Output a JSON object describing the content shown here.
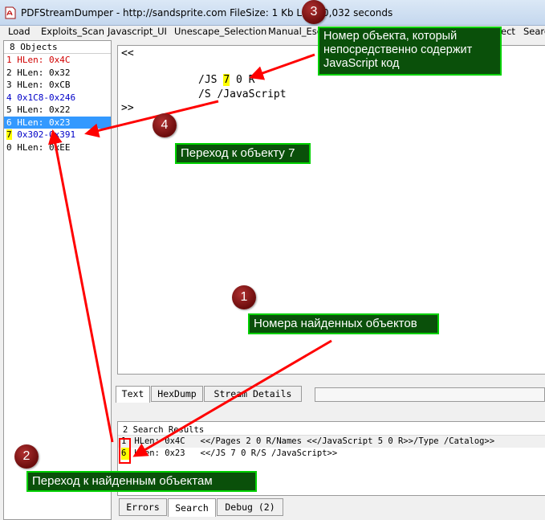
{
  "window": {
    "title": "PDFStreamDumper  - http://sandsprite.com      FileSize: 1 Kb    Load    0,032 seconds"
  },
  "menu": [
    "Load",
    "Exploits_Scan",
    "Javascript_UI",
    "Unescape_Selection",
    "Manual_Esc",
    "ect",
    "Search"
  ],
  "objects": {
    "header": "8 Objects",
    "items": [
      {
        "label": "1 HLen: 0x4C"
      },
      {
        "label": "2 HLen: 0x32"
      },
      {
        "label": "3 HLen: 0xCB"
      },
      {
        "label": "4 0x1C8-0x246"
      },
      {
        "label": "5 HLen: 0x22"
      },
      {
        "label": "6 HLen: 0x23"
      },
      {
        "num": "7",
        "label": " 0x302-0x391"
      },
      {
        "label": "0 HLen: 0xEE"
      }
    ]
  },
  "content": {
    "line1": "<<",
    "line2a": "/JS ",
    "line2num": "7",
    "line2b": " 0 R",
    "line3": "/S /JavaScript",
    "line4": ">>"
  },
  "tabs": [
    "Text",
    "HexDump",
    "Stream Details"
  ],
  "search": {
    "header": "2 Search Results",
    "rows": [
      {
        "num": "1",
        "text": " HLen: 0x4C   <</Pages 2 0 R/Names <</JavaScript 5 0 R>>/Type /Catalog>>"
      },
      {
        "num": "6",
        "text": " HLen: 0x23   <</JS 7 0 R/S /JavaScript>>"
      }
    ]
  },
  "bottom_tabs": [
    "Errors",
    "Search",
    "Debug (2)"
  ],
  "annotations": {
    "callout_js_object": "Номер объекта, который\nнепосредственно содержит\nJavaScript код",
    "callout_goto7": "Переход к объекту 7",
    "callout_found": "Номера найденных объектов",
    "callout_goto_found": "Переход к найденным объектам",
    "markers": [
      "1",
      "2",
      "3",
      "4"
    ]
  },
  "colors": {
    "callout_bg": "#0a500a",
    "callout_border": "#00d000",
    "arrow": "#ff0000",
    "highlight": "#ffff00",
    "selection": "#3399ff"
  }
}
